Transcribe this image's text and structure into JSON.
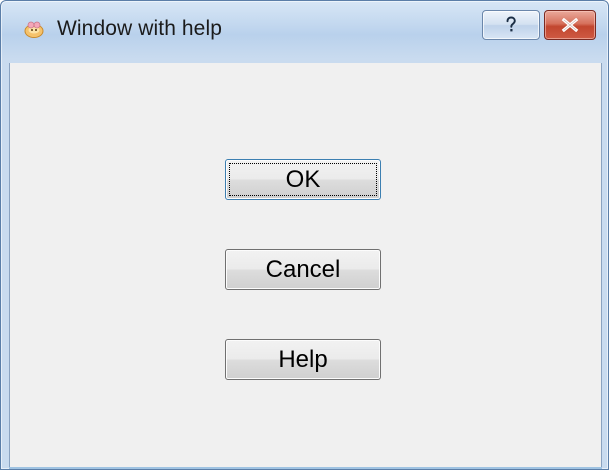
{
  "window": {
    "title": "Window with help",
    "icon": "app-icon"
  },
  "caption_buttons": {
    "help_icon": "question-mark-icon",
    "close_icon": "close-x-icon"
  },
  "buttons": {
    "ok_label": "OK",
    "cancel_label": "Cancel",
    "help_label": "Help"
  },
  "colors": {
    "titlebar": "#c6daf0",
    "client_bg": "#f0f0f0",
    "close_button": "#c2462f",
    "default_button_border": "#3c7fb1"
  }
}
